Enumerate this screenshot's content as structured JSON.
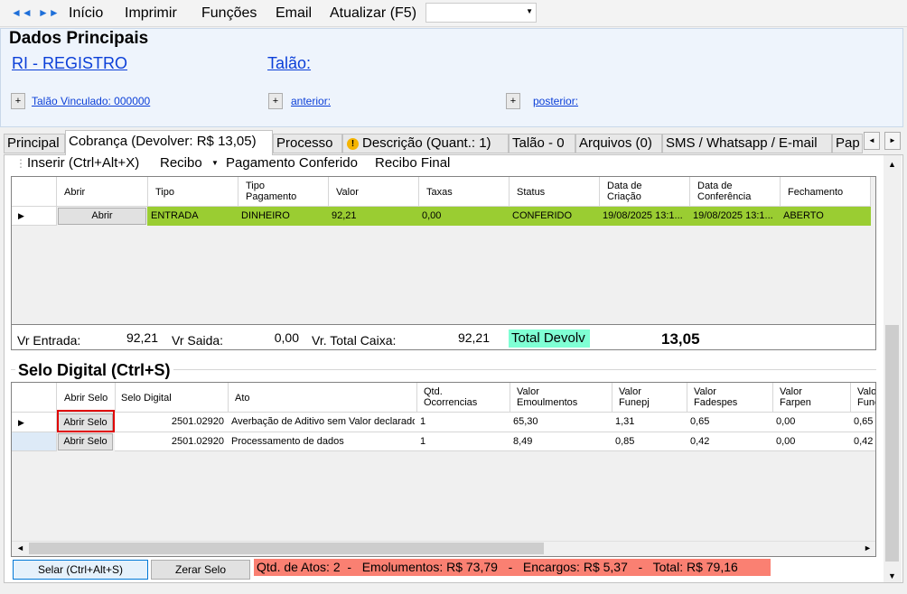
{
  "menu": {
    "back_icon": "◄◄",
    "forward_icon": "►►",
    "items": [
      "Início",
      "Imprimir",
      "Funções",
      "Email",
      "Atualizar (F5)"
    ]
  },
  "header": {
    "title": "Dados Principais",
    "registro_link": "RI - REGISTRO",
    "talao_link": "Talão:",
    "plus": "+",
    "vinculado_link": "Talão Vinculado: 000000",
    "anterior_link": "anterior:",
    "posterior_link": "posterior:"
  },
  "tabs": [
    "Principal",
    "Cobrança (Devolver: R$ 13,05)",
    "Processo",
    "Descrição (Quant.: 1)",
    "Talão - 0",
    "Arquivos (0)",
    "SMS / Whatsapp / E-mail",
    "Pap"
  ],
  "warn_glyph": "!",
  "toolbar": {
    "insert": "Inserir (Ctrl+Alt+X)",
    "recibo": "Recibo",
    "pagamento": "Pagamento Conferido",
    "recibo_final": "Recibo Final"
  },
  "payments": {
    "headers": [
      "Abrir",
      "Tipo",
      "Tipo\nPagamento",
      "Valor",
      "Taxas",
      "Status",
      "Data de\nCriação",
      "Data de\nConferência",
      "Fechamento"
    ],
    "row": {
      "button": "Abrir",
      "tipo": "ENTRADA",
      "tipo_pagamento": "DINHEIRO",
      "valor": "92,21",
      "taxas": "0,00",
      "status": "CONFERIDO",
      "data_criacao": "19/08/2025 13:1...",
      "data_conferencia": "19/08/2025 13:1...",
      "fechamento": "ABERTO"
    },
    "row_color": "#9acd32"
  },
  "totals": {
    "entrada_label": "Vr Entrada:",
    "entrada_value": "92,21",
    "saida_label": "Vr Saida:",
    "saida_value": "0,00",
    "total_caixa_label": "Vr. Total Caixa:",
    "total_caixa_value": "92,21",
    "devolver_label": "Total Devolv",
    "devolver_value": "13,05"
  },
  "selo": {
    "title": "Selo Digital (Ctrl+S)",
    "headers": [
      "Abrir Selo",
      "Selo Digital",
      "Ato",
      "Qtd.\nOcorrencias",
      "Valor\nEmoulmentos",
      "Valor\nFunepj",
      "Valor\nFadespes",
      "Valor\nFarpen",
      "Valo\nFune"
    ],
    "rows": [
      {
        "button": "Abrir Selo",
        "selo": "2501.02920",
        "ato": "Averbação de Aditivo sem Valor declarado",
        "qtd": "1",
        "emol": "65,30",
        "funepj": "1,31",
        "fadespes": "0,65",
        "farpen": "0,00",
        "fune": "0,65"
      },
      {
        "button": "Abrir Selo",
        "selo": "2501.02920",
        "ato": "Processamento de dados",
        "qtd": "1",
        "emol": "8,49",
        "funepj": "0,85",
        "fadespes": "0,42",
        "farpen": "0,00",
        "fune": "0,42"
      }
    ],
    "selar_button": "Selar (Ctrl+Alt+S)",
    "zerar_button": "Zerar Selo",
    "summary": "Qtd. de Atos: 2  -   Emolumentos: R$ 73,79   -   Encargos: R$ 5,37   -   Total: R$ 79,16"
  },
  "colors": {
    "accent": "#0b3fd8",
    "devolver_bg": "#7fffd4",
    "summary_bg": "#fa8072",
    "highlight": "#e00000"
  }
}
